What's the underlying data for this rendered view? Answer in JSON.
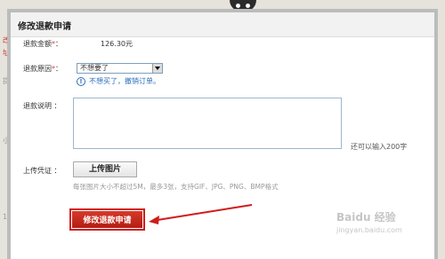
{
  "background": {
    "ghost_texts": [
      "改",
      "址",
      "提",
      "小",
      "1"
    ]
  },
  "dialog": {
    "title": "修改退款申请"
  },
  "form": {
    "amount_label": "退款金额",
    "amount_value": "126.30元",
    "reason_label": "退款原因",
    "reason_selected": "不想要了",
    "hint_text": "不想买了，撤销订单。",
    "desc_label": "退款说明 ：",
    "desc_value": "",
    "remaining_text": "还可以输入200字",
    "upload_label": "上传凭证 ：",
    "upload_button": "上传图片",
    "upload_note": "每张图片大小不超过5M，最多3张，支持GIF、JPG、PNG、BMP格式",
    "submit_button": "修改退款申请",
    "required_mark": "*"
  },
  "watermark": {
    "text": "Baidu 经验",
    "sub": "jingyan.baidu.com"
  },
  "colors": {
    "accent_red": "#d11b1b",
    "hint_blue": "#2a6ebb"
  }
}
